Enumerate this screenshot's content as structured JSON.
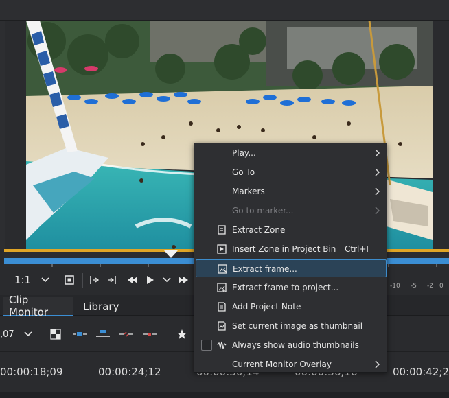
{
  "monitor": {
    "zoom_label": "1:1",
    "audio_scale": [
      "-10",
      "-5",
      "-2",
      "0"
    ]
  },
  "tabs": [
    {
      "label": "Clip Monitor",
      "active": true
    },
    {
      "label": "Library",
      "active": false
    }
  ],
  "toolbar2": {
    "timecode_fragment": ",07"
  },
  "ruler": {
    "labels": [
      "00:00:18;09",
      "00:00:24;12",
      "00:00:30;14",
      "00:00:36;16",
      "00:00:42;2"
    ]
  },
  "context_menu": {
    "items": [
      {
        "label": "Play...",
        "submenu": true,
        "icon": "",
        "enabled": true
      },
      {
        "label": "Go To",
        "submenu": true,
        "icon": "",
        "enabled": true
      },
      {
        "label": "Markers",
        "submenu": true,
        "icon": "",
        "enabled": true
      },
      {
        "label": "Go to marker...",
        "submenu": true,
        "icon": "",
        "enabled": false
      },
      {
        "label": "Extract Zone",
        "submenu": false,
        "icon": "extract-zone-icon",
        "enabled": true
      },
      {
        "label": "Insert Zone in Project Bin",
        "shortcut": "Ctrl+I",
        "submenu": false,
        "icon": "insert-zone-icon",
        "enabled": true
      },
      {
        "label": "Extract frame...",
        "submenu": false,
        "icon": "extract-frame-icon",
        "enabled": true,
        "highlighted": true
      },
      {
        "label": "Extract frame to project...",
        "submenu": false,
        "icon": "extract-frame-project-icon",
        "enabled": true
      },
      {
        "label": "Add Project Note",
        "submenu": false,
        "icon": "add-note-icon",
        "enabled": true
      },
      {
        "label": "Set current image as thumbnail",
        "submenu": false,
        "icon": "thumbnail-icon",
        "enabled": true
      },
      {
        "label": "Always show audio thumbnails",
        "submenu": false,
        "icon": "audio-thumbnail-icon",
        "enabled": true,
        "checkbox": true,
        "checked": false
      },
      {
        "label": "Current Monitor Overlay",
        "submenu": true,
        "icon": "",
        "enabled": true
      }
    ]
  },
  "colors": {
    "accent": "#3b8ed4",
    "zone": "#e0a526",
    "menu_bg": "#2e2f32",
    "highlight_bg": "#2b4357"
  }
}
